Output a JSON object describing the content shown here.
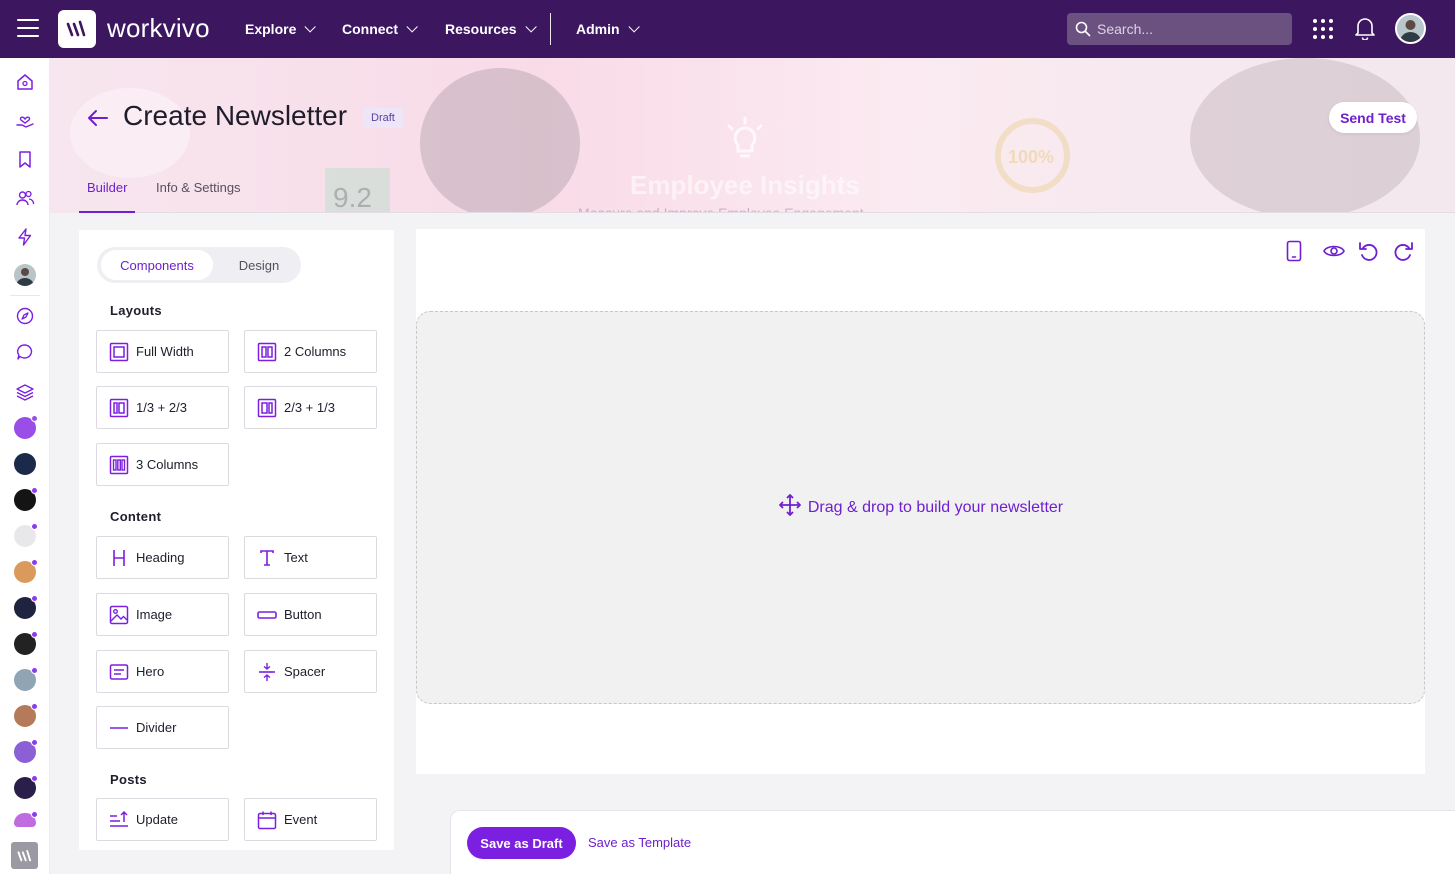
{
  "app": {
    "logo_text": "workvivo"
  },
  "topnav": {
    "items": [
      {
        "label": "Explore"
      },
      {
        "label": "Connect"
      },
      {
        "label": "Resources"
      },
      {
        "label": "Admin"
      }
    ],
    "search_placeholder": "Search..."
  },
  "banner": {
    "title": "Employee Insights",
    "subtitle": "Measure and Improve Employee Engagement",
    "score": "9.2",
    "percent": "100%"
  },
  "header": {
    "title": "Create Newsletter",
    "status_badge": "Draft",
    "send_test_label": "Send Test"
  },
  "tabs": [
    {
      "label": "Builder"
    },
    {
      "label": "Info & Settings"
    }
  ],
  "panel": {
    "segment": {
      "components": "Components",
      "design": "Design"
    },
    "layouts": {
      "heading": "Layouts",
      "items": [
        "Full Width",
        "2 Columns",
        "1/3 + 2/3",
        "2/3 + 1/3",
        "3 Columns"
      ]
    },
    "content": {
      "heading": "Content",
      "items": [
        "Heading",
        "Text",
        "Image",
        "Button",
        "Hero",
        "Spacer",
        "Divider"
      ]
    },
    "posts": {
      "heading": "Posts",
      "items": [
        "Update",
        "Event"
      ]
    }
  },
  "canvas": {
    "drop_text": "Drag & drop to build your newsletter"
  },
  "footer": {
    "save_draft_label": "Save as Draft",
    "save_template_label": "Save as Template"
  },
  "colors": {
    "topbar": "#3c1760",
    "accent": "#6f1fcf",
    "primary_button": "#7b1fe0"
  }
}
